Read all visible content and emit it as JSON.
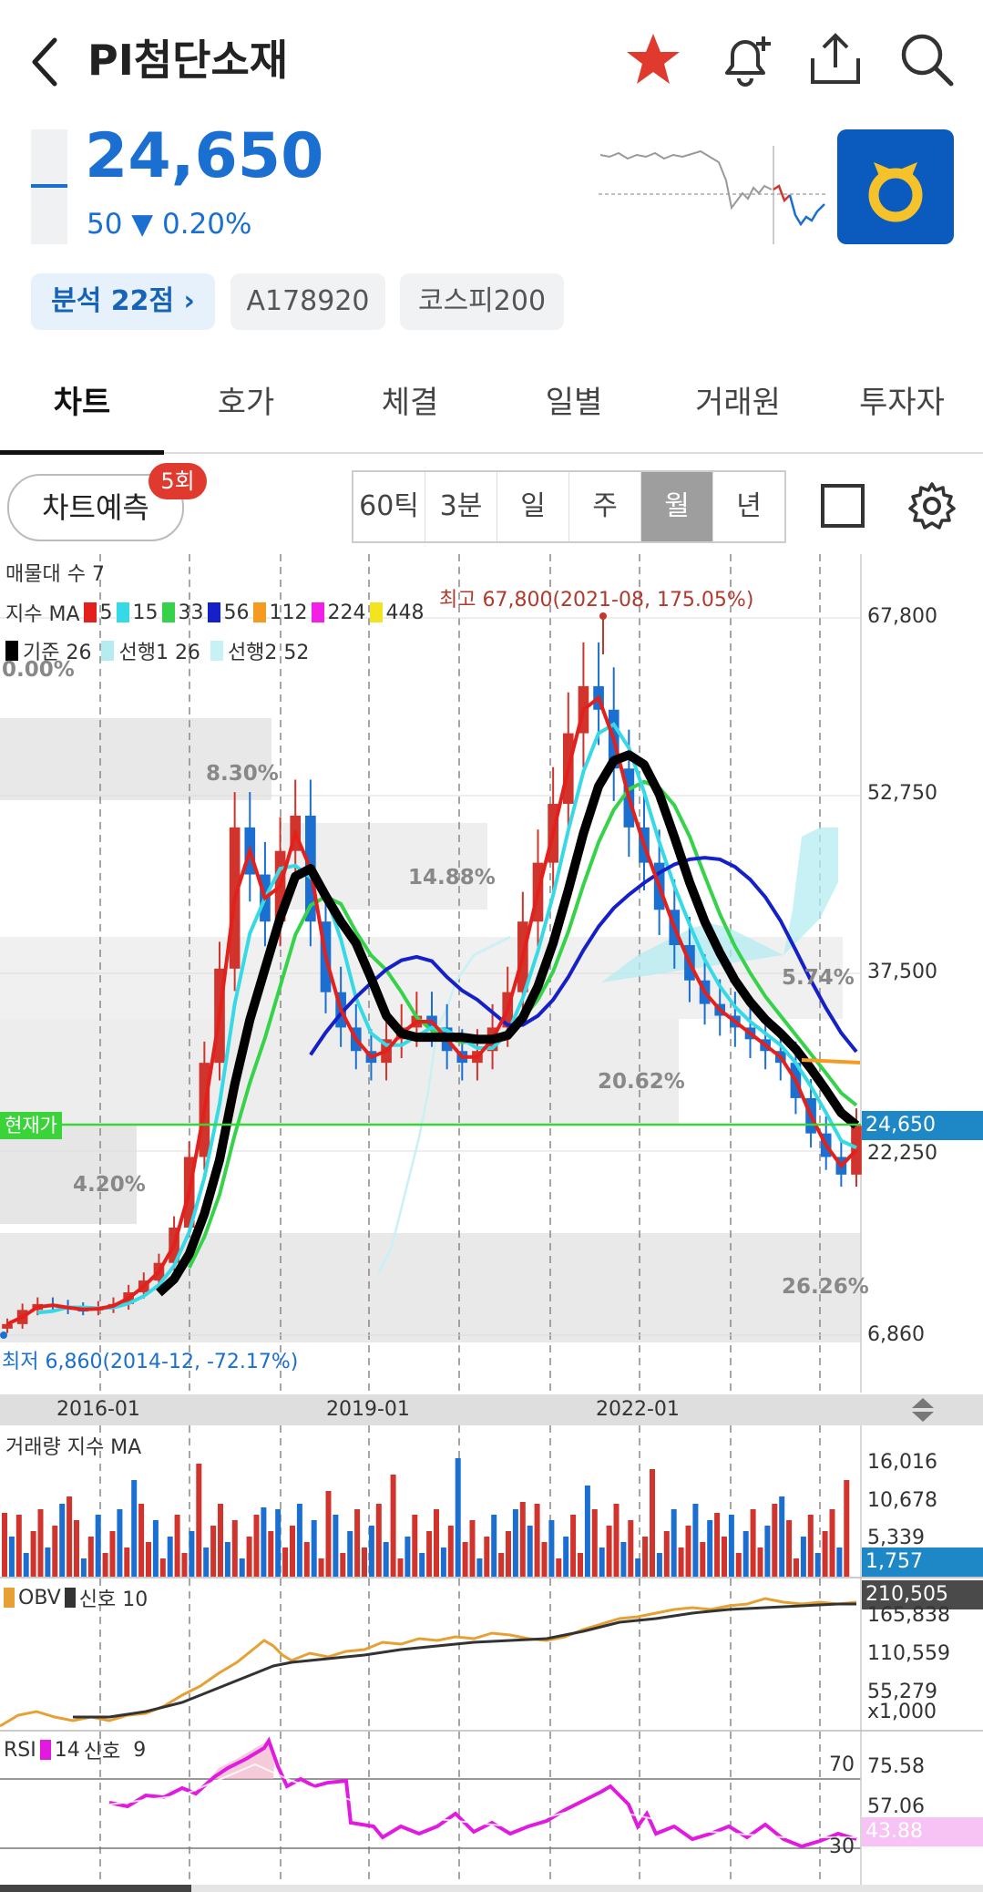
{
  "header": {
    "title": "PI첨단소재",
    "price": "24,650",
    "change": "50 ▼ 0.20%"
  },
  "chips": {
    "analysis": "분석 22점 ›",
    "code": "A178920",
    "index": "코스피200"
  },
  "tabs": [
    "차트",
    "호가",
    "체결",
    "일별",
    "거래원",
    "투자자"
  ],
  "toolbar": {
    "predict_label": "차트예측",
    "predict_badge": "5회",
    "periods": [
      "60틱",
      "3분",
      "일",
      "주",
      "월",
      "년"
    ],
    "active_period": "월"
  },
  "icons": [
    "back-icon",
    "star-icon",
    "bell-plus-icon",
    "share-icon",
    "search-icon",
    "checkbox-icon",
    "gear-icon",
    "sort-icon",
    "company-logo"
  ],
  "colors": {
    "accent_blue": "#1a6fd1",
    "up_red": "#d0342c",
    "star_red": "#e03a2f"
  },
  "chart_labels": {
    "volume_profile": "매물대 수 7",
    "ma_prefix": "지수 MA",
    "ma": [
      "5",
      "15",
      "33",
      "56",
      "112",
      "224",
      "448"
    ],
    "ichimoku": [
      "기준 26",
      "선행1 26",
      "선행2 52"
    ],
    "high": "최고 67,800(2021-08, 175.05%)",
    "low": "최저 6,860(2014-12, -72.17%)",
    "current_tag": "현재가",
    "current_price": "24,650",
    "profile_pcts": [
      "0.00%",
      "8.30%",
      "14.88%",
      "5.74%",
      "20.62%",
      "4.20%",
      "26.26%"
    ]
  },
  "chart_data": [
    {
      "type": "candlestick",
      "title": "",
      "x_ticks": [
        "2016-01",
        "2019-01",
        "2022-01"
      ],
      "y_ticks": [
        "67,800",
        "52,750",
        "37,500",
        "22,250",
        "6,860"
      ],
      "ylim": [
        6860,
        67800
      ],
      "high": 67800,
      "low": 6860,
      "current": 24650,
      "close_series": [
        7800,
        9000,
        9500,
        9300,
        9100,
        9000,
        9200,
        9500,
        10500,
        11500,
        13000,
        16000,
        22000,
        30000,
        38000,
        50000,
        46000,
        42000,
        48000,
        51000,
        42000,
        36000,
        33000,
        31000,
        30000,
        32000,
        33000,
        34000,
        33000,
        31000,
        30000,
        31000,
        33000,
        36000,
        42000,
        47000,
        52000,
        58000,
        62000,
        60000,
        55000,
        50000,
        47000,
        43000,
        40000,
        37000,
        35000,
        34000,
        33000,
        32000,
        31000,
        30000,
        27000,
        24000,
        22000,
        20500,
        24650
      ]
    },
    {
      "type": "bar",
      "title": "거래량 지수 MA",
      "y_ticks": [
        "16,016",
        "10,678",
        "5,339"
      ],
      "last": "1,757"
    },
    {
      "type": "line",
      "title": "OBV",
      "legend": [
        "OBV",
        "신호 10"
      ],
      "y_ticks": [
        "165,838",
        "110,559",
        "55,279",
        "x1,000"
      ],
      "last": "210,505"
    },
    {
      "type": "line",
      "title": "RSI",
      "legend": [
        "RSI",
        "14",
        "신호",
        "9"
      ],
      "y_ticks": [
        "75.58",
        "57.06"
      ],
      "levels": [
        "70",
        "30"
      ],
      "last": "43.88"
    }
  ]
}
